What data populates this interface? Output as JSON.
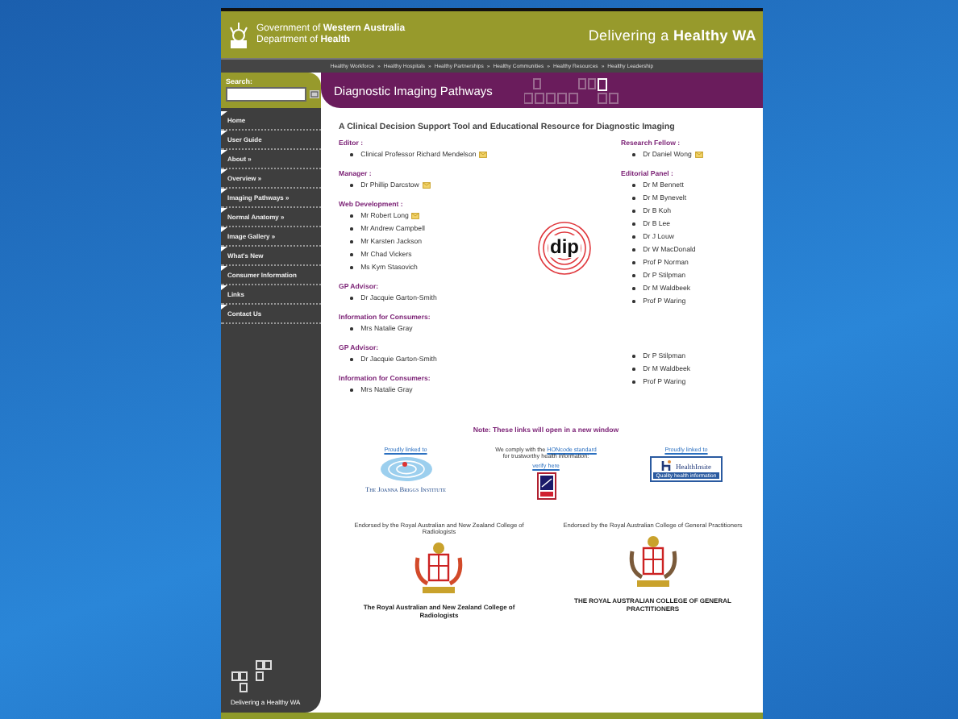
{
  "header": {
    "government": "Government of **Western Australia**",
    "department": "Department of **Health**",
    "tagline": "Delivering a **Healthy WA**"
  },
  "nav_links": [
    "Healthy Workforce",
    "Healthy Hospitals",
    "Healthy Partnerships",
    "Healthy Communities",
    "Healthy Resources",
    "Healthy Leadership"
  ],
  "nav_separator": "»",
  "search": {
    "label": "Search:"
  },
  "sidebar_items": [
    {
      "label": "Home"
    },
    {
      "label": "User Guide"
    },
    {
      "label": "About »"
    },
    {
      "label": "Overview »"
    },
    {
      "label": "Imaging Pathways »"
    },
    {
      "label": "Normal Anatomy »"
    },
    {
      "label": "Image Gallery »"
    },
    {
      "label": "What's New"
    },
    {
      "label": "Consumer Information"
    },
    {
      "label": "Links"
    },
    {
      "label": "Contact Us"
    }
  ],
  "sidebar_footer": "Delivering a Healthy WA",
  "page_title": "Diagnostic Imaging Pathways",
  "subtitle": "A Clinical Decision Support Tool and Educational Resource for Diagnostic Imaging",
  "left_sections": [
    {
      "heading": "Editor :",
      "people": [
        {
          "name": "Clinical Professor Richard Mendelson",
          "email": true
        }
      ]
    },
    {
      "heading": "Manager :",
      "people": [
        {
          "name": "Dr Phillip Darcstow",
          "email": true
        }
      ]
    },
    {
      "heading": "Web Development :",
      "people": [
        {
          "name": "Mr Robert Long",
          "email": true
        },
        {
          "name": "Mr Andrew Campbell",
          "email": false
        },
        {
          "name": "Mr Karsten Jackson",
          "email": false
        },
        {
          "name": "Mr Chad Vickers",
          "email": false
        },
        {
          "name": "Ms Kym Stasovich",
          "email": false
        }
      ]
    },
    {
      "heading": "GP Advisor:",
      "people": [
        {
          "name": "Dr Jacquie Garton-Smith",
          "email": false
        }
      ]
    },
    {
      "heading": "Information for Consumers:",
      "people": [
        {
          "name": "Mrs Natalie Gray",
          "email": false
        }
      ]
    },
    {
      "heading": "GP Advisor:",
      "people": [
        {
          "name": "Dr Jacquie Garton-Smith",
          "email": false
        }
      ]
    },
    {
      "heading": "Information for Consumers:",
      "people": [
        {
          "name": "Mrs Natalie Gray",
          "email": false
        }
      ]
    }
  ],
  "logo_text": "dip",
  "right_sections": [
    {
      "heading": "Research Fellow :",
      "people": [
        {
          "name": "Dr Daniel Wong",
          "email": true
        }
      ]
    },
    {
      "heading": "Editorial Panel :",
      "people": [
        {
          "name": "Dr M Bennett",
          "email": false
        },
        {
          "name": "Dr M Bynevelt",
          "email": false
        },
        {
          "name": "Dr B Koh",
          "email": false
        },
        {
          "name": "Dr B Lee",
          "email": false
        },
        {
          "name": "Dr J Louw",
          "email": false
        },
        {
          "name": "Dr W MacDonald",
          "email": false
        },
        {
          "name": "Prof P Norman",
          "email": false
        },
        {
          "name": "Dr P Stilpman",
          "email": false
        },
        {
          "name": "Dr M Waldbeek",
          "email": false
        },
        {
          "name": "Prof P Waring",
          "email": false
        }
      ]
    },
    {
      "people": [
        {
          "name": "Dr P Stilpman",
          "email": false
        },
        {
          "name": "Dr M Waldbeek",
          "email": false
        },
        {
          "name": "Prof P Waring",
          "email": false
        }
      ]
    }
  ],
  "note": "Note: These links will open in a new window",
  "partners": [
    {
      "kind": "jbi",
      "link": "Proudly linked to",
      "logo_text": "The Joanna Briggs Institute"
    },
    {
      "kind": "hon",
      "text_before": "We comply with the",
      "link": "HONcode standard",
      "text_after": "for trustworthy health information:",
      "verify": "verify here"
    },
    {
      "kind": "healthinsite",
      "link": "Proudly linked to",
      "logo_text": "HealthInsite",
      "caption": "Quality health information"
    }
  ],
  "endorsements": [
    {
      "text": "Endorsed by the Royal Australian and New Zealand College of Radiologists",
      "crest_caption": "The Royal Australian and New Zealand College of Radiologists"
    },
    {
      "text": "Endorsed by the Royal Australian College of General Practitioners",
      "crest_caption": "THE ROYAL AUSTRALIAN COLLEGE OF GENERAL PRACTITIONERS"
    }
  ]
}
